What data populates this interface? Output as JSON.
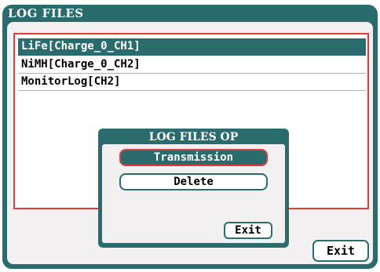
{
  "window": {
    "title": "LOG FILES"
  },
  "log_list": {
    "items": [
      {
        "label": "LiFe[Charge_0_CH1]",
        "selected": true
      },
      {
        "label": "NiMH[Charge_0_CH2]",
        "selected": false
      },
      {
        "label": "MonitorLog[CH2]",
        "selected": false
      }
    ]
  },
  "dialog": {
    "title": "LOG FILES OP",
    "transmission_label": "Transmission",
    "delete_label": "Delete",
    "exit_label": "Exit"
  },
  "footer": {
    "exit_label": "Exit"
  },
  "colors": {
    "accent": "#2a6b6e",
    "highlight_border": "#e23b3b",
    "panel": "#f3f0f1"
  }
}
